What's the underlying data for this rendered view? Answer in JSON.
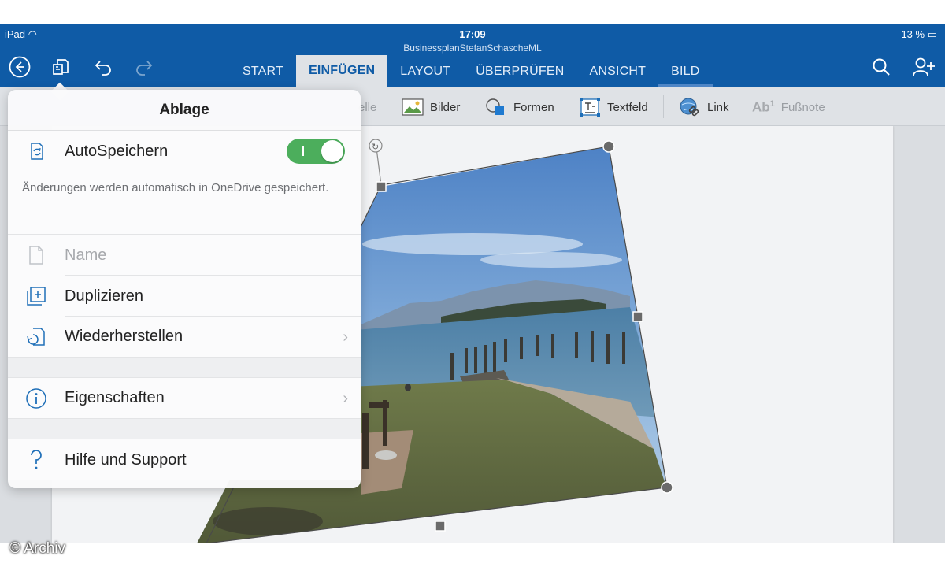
{
  "status_bar": {
    "device": "iPad",
    "time": "17:09",
    "battery": "13 %"
  },
  "document_title": "BusinessplanStefanSchascheML",
  "tabs": [
    {
      "label": "START",
      "active": false
    },
    {
      "label": "EINFÜGEN",
      "active": true
    },
    {
      "label": "LAYOUT",
      "active": false
    },
    {
      "label": "ÜBERPRÜFEN",
      "active": false
    },
    {
      "label": "ANSICHT",
      "active": false
    },
    {
      "label": "BILD",
      "active": false
    }
  ],
  "ribbon": {
    "tabelle": "elle",
    "bilder": "Bilder",
    "formen": "Formen",
    "textfeld": "Textfeld",
    "link": "Link",
    "fussnote": "Fußnote"
  },
  "popover": {
    "title": "Ablage",
    "autosave_label": "AutoSpeichern",
    "autosave_on": true,
    "autosave_description": "Änderungen werden automatisch in OneDrive gespeichert.",
    "name_label": "Name",
    "duplicate_label": "Duplizieren",
    "restore_label": "Wiederherstellen",
    "properties_label": "Eigenschaften",
    "help_label": "Hilfe und Support"
  },
  "watermark": "© Archiv",
  "colors": {
    "ribbon_blue": "#0f5ba6",
    "toggle_green": "#4cae5c",
    "icon_blue": "#1f6fb8"
  }
}
